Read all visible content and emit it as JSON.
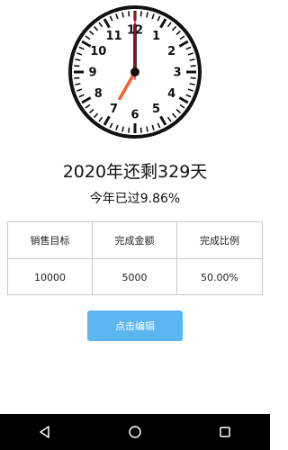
{
  "clock": {
    "numbers": [
      "12",
      "1",
      "2",
      "3",
      "4",
      "5",
      "6",
      "7",
      "8",
      "9",
      "10",
      "11"
    ],
    "time": {
      "hour": 7,
      "minute": 0,
      "second": 0
    },
    "colors": {
      "hour_hand": "#ff5a2a",
      "minute_hand": "#000000",
      "second_hand": "#e0102a",
      "face": "#ffffff",
      "rim": "#111111"
    }
  },
  "summary": {
    "remaining_days": "2020年还剩329天",
    "elapsed_percent": "今年已过9.86%"
  },
  "table": {
    "headers": [
      "销售目标",
      "完成金额",
      "完成比例"
    ],
    "rows": [
      [
        "10000",
        "5000",
        "50.00%"
      ]
    ]
  },
  "buttons": {
    "edit_label": "点击编辑"
  },
  "navigation": {
    "icons": [
      "back-icon",
      "home-icon",
      "recents-icon"
    ]
  },
  "colors": {
    "accent": "#5bb6ef",
    "border": "#c9c9c9",
    "navbar": "#000000"
  }
}
